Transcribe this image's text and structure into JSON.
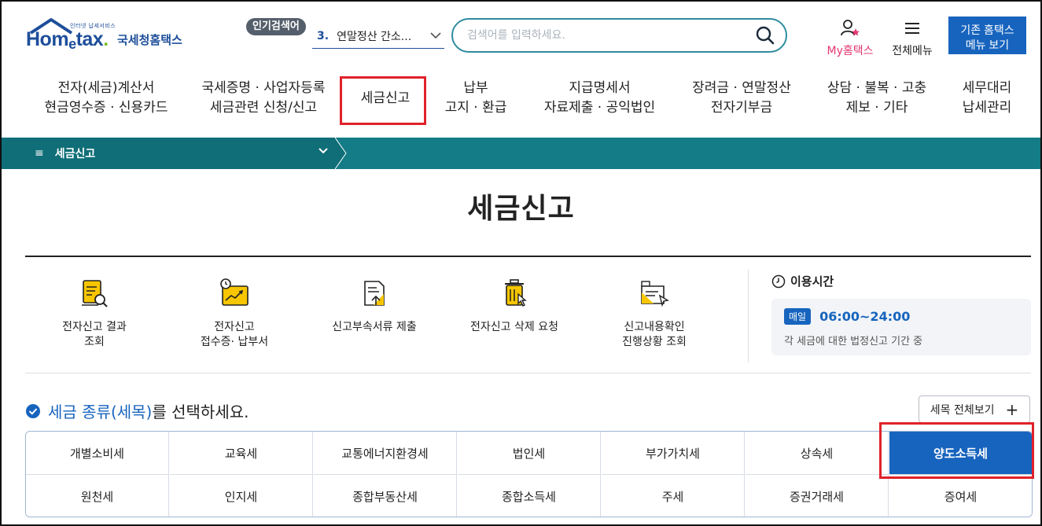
{
  "brand": {
    "logo_small_text": "인터넷 납세서비스",
    "logo_word_a": "Hom",
    "logo_word_e": "e",
    "logo_word_b": "tax",
    "logo_word_dot": ".",
    "logo_kr": "국세청홈택스",
    "primary_color": "#1d4e9a",
    "accent_color": "#1764be",
    "teal_color": "#137c86"
  },
  "header": {
    "hot_badge": "인기검색어",
    "hot_keyword_num": "3.",
    "hot_keyword_text": "연말정산 간소...",
    "search_placeholder": "검색어를 입력하세요.",
    "my_hometax": "My홈택스",
    "all_menu": "전체메뉴",
    "legacy_line1": "기존 홈택스",
    "legacy_line2": "메뉴 보기"
  },
  "gnb": [
    {
      "line1": "전자(세금)계산서",
      "line2": "현금영수증 · 신용카드"
    },
    {
      "line1": "국세증명 · 사업자등록",
      "line2": "세금관련 신청/신고"
    },
    {
      "line1": "세금신고",
      "line2": ""
    },
    {
      "line1": "납부",
      "line2": "고지 · 환급"
    },
    {
      "line1": "지급명세서",
      "line2": "자료제출 · 공익법인"
    },
    {
      "line1": "장려금 · 연말정산",
      "line2": "전자기부금"
    },
    {
      "line1": "상담 · 불복 · 고충",
      "line2": "제보 · 기타"
    },
    {
      "line1": "세무대리",
      "line2": "납세관리"
    }
  ],
  "breadcrumb": {
    "label": "세금신고"
  },
  "page": {
    "title": "세금신고"
  },
  "quick_menu": [
    {
      "line1": "전자신고 결과",
      "line2": "조회",
      "icon": "document-search-icon"
    },
    {
      "line1": "전자신고",
      "line2": "접수증· 납부서",
      "icon": "receipt-clock-icon"
    },
    {
      "line1": "신고부속서류 제출",
      "line2": "",
      "icon": "document-upload-icon"
    },
    {
      "line1": "전자신고 삭제 요청",
      "line2": "",
      "icon": "trash-click-icon"
    },
    {
      "line1": "신고내용확인",
      "line2": "진행상황 조회",
      "icon": "folder-cursor-icon"
    }
  ],
  "hours": {
    "title": "이용시간",
    "badge": "매일",
    "time": "06:00~24:00",
    "note": "각 세금에 대한 법정신고 기간 중"
  },
  "tax_section": {
    "heading_highlight": "세금 종류(세목)",
    "heading_rest": "를 선택하세요.",
    "all_button": "세목 전체보기",
    "row1": [
      "개별소비세",
      "교육세",
      "교통에너지환경세",
      "법인세",
      "부가가치세",
      "상속세",
      "양도소득세"
    ],
    "row2": [
      "원천세",
      "인지세",
      "종합부동산세",
      "종합소득세",
      "주세",
      "증권거래세",
      "증여세"
    ],
    "selected": "양도소득세"
  }
}
